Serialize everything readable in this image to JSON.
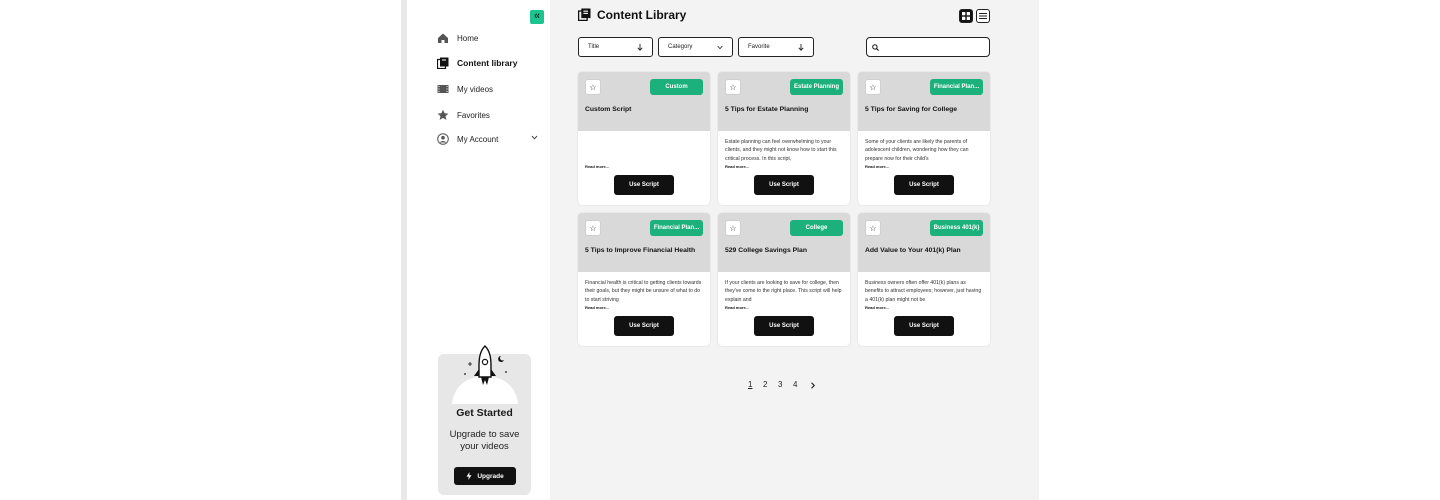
{
  "sidebar": {
    "collapse_icon": "double-chevron-left-icon",
    "nav": [
      {
        "label": "Home",
        "icon": "home-icon"
      },
      {
        "label": "Content library",
        "icon": "library-icon",
        "active": true
      },
      {
        "label": "My videos",
        "icon": "video-icon"
      },
      {
        "label": "Favorites",
        "icon": "star-icon"
      },
      {
        "label": "My Account",
        "icon": "account-icon",
        "has_chevron": true
      }
    ],
    "promo": {
      "title": "Get Started",
      "subtitle": "Upgrade to save your videos",
      "button": "Upgrade"
    }
  },
  "main": {
    "title": "Content Library",
    "filters": [
      {
        "label": "Title",
        "indicator": "arrow-down"
      },
      {
        "label": "Category",
        "indicator": "chevron-down"
      },
      {
        "label": "Favorite",
        "indicator": "arrow-down"
      }
    ],
    "search": {
      "placeholder": "",
      "value": ""
    },
    "cards": [
      {
        "tag": "Custom",
        "title": "Custom Script",
        "desc": "",
        "read_more": "Read more...",
        "button": "Use Script"
      },
      {
        "tag": "Estate Planning",
        "title": "5 Tips for Estate Planning",
        "desc": "Estate planning can feel overwhelming to your clients, and they might not know how to start this critical process. In this script,",
        "read_more": "Read more...",
        "button": "Use Script"
      },
      {
        "tag": "Financial Plan...",
        "title": "5 Tips for Saving for College",
        "desc": "Some of your clients are likely the parents of adolescent children, wondering how they can prepare now for their child's",
        "read_more": "Read more...",
        "button": "Use Script"
      },
      {
        "tag": "Financial Plan...",
        "title": "5 Tips to Improve Financial Health",
        "desc": "Financial health is critical to getting clients towards their goals, but they might be unsure of what to do to start striving",
        "read_more": "Read more...",
        "button": "Use Script"
      },
      {
        "tag": "College",
        "title": "529 College Savings Plan",
        "desc": "If your clients are looking to save for college, then they've come to the right place. This script will help explain and",
        "read_more": "Read more...",
        "button": "Use Script"
      },
      {
        "tag": "Business 401(k)",
        "title": "Add Value to Your 401(k) Plan",
        "desc": "Business owners often offer 401(k) plans as benefits to attract employees; however, just having a 401(k) plan might not be",
        "read_more": "Read more...",
        "button": "Use Script"
      }
    ],
    "pagination": {
      "pages": [
        "1",
        "2",
        "3",
        "4"
      ],
      "current": "1",
      "next_icon": "chevron-right-icon"
    }
  },
  "colors": {
    "accent": "#1cb07c",
    "collapse": "#1cc48f",
    "dark": "#111111",
    "main_bg": "#f3f3f3",
    "card_head": "#d9d9d9"
  }
}
